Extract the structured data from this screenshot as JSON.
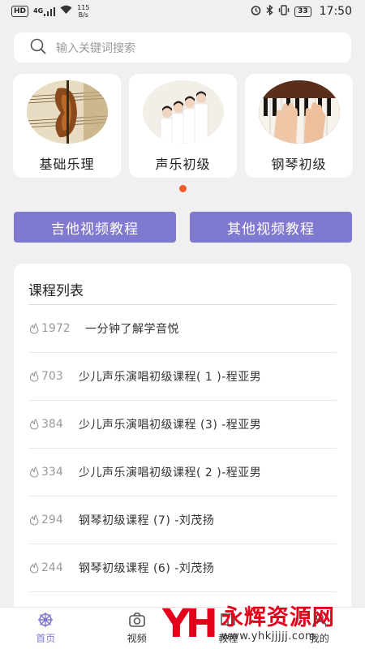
{
  "status_bar": {
    "hd": "HD",
    "signal": "4G",
    "net_speed": "115",
    "net_unit": "B/s",
    "battery": "33",
    "time": "17:50"
  },
  "search": {
    "placeholder": "输入关键词搜索"
  },
  "categories": [
    {
      "label": "基础乐理",
      "image": "sheet-music-violin"
    },
    {
      "label": "声乐初级",
      "image": "children-choir"
    },
    {
      "label": "钢琴初级",
      "image": "hands-on-piano"
    }
  ],
  "carousel": {
    "active_index": 0,
    "dot_color": "#f05a28"
  },
  "buttons": {
    "guitar": "吉他视频教程",
    "other": "其他视频教程",
    "color": "#7f79d0"
  },
  "course_list": {
    "title": "课程列表",
    "items": [
      {
        "count": "1972",
        "name": "一分钟了解学音悦"
      },
      {
        "count": "703",
        "name": "少儿声乐演唱初级课程( 1 )-程亚男"
      },
      {
        "count": "384",
        "name": "少儿声乐演唱初级课程 (3) -程亚男"
      },
      {
        "count": "334",
        "name": "少儿声乐演唱初级课程( 2 )-程亚男"
      },
      {
        "count": "294",
        "name": "钢琴初级课程 (7) -刘茂扬"
      },
      {
        "count": "244",
        "name": "钢琴初级课程 (6) -刘茂扬"
      }
    ]
  },
  "tabs": [
    {
      "label": "首页",
      "icon": "home-wheel-icon",
      "active": true
    },
    {
      "label": "视频",
      "icon": "camera-icon",
      "active": false
    },
    {
      "label": "教程",
      "icon": "book-icon",
      "active": false
    },
    {
      "label": "我的",
      "icon": "user-icon",
      "active": false
    }
  ],
  "watermark": {
    "logo": "YH",
    "title": "永辉资源网",
    "url": "www.yhkjjjjj.com"
  }
}
